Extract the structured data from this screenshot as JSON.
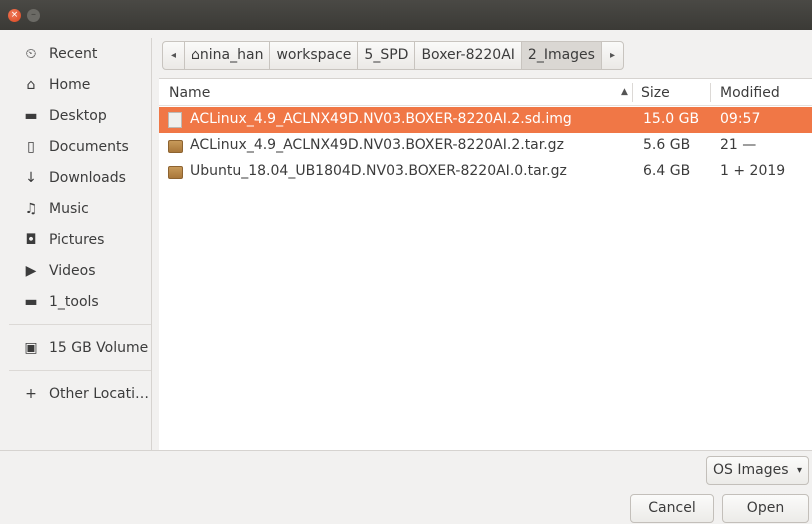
{
  "titlebar": {
    "close_glyph": "×",
    "minimize_glyph": "–"
  },
  "sidebar": {
    "items": [
      {
        "label": "Recent",
        "icon": "clock-icon"
      },
      {
        "label": "Home",
        "icon": "home-icon"
      },
      {
        "label": "Desktop",
        "icon": "folder-icon"
      },
      {
        "label": "Documents",
        "icon": "document-icon"
      },
      {
        "label": "Downloads",
        "icon": "download-icon"
      },
      {
        "label": "Music",
        "icon": "music-icon"
      },
      {
        "label": "Pictures",
        "icon": "camera-icon"
      },
      {
        "label": "Videos",
        "icon": "video-icon"
      },
      {
        "label": "1_tools",
        "icon": "folder-icon"
      },
      {
        "label": "15 GB Volume",
        "icon": "drive-icon"
      },
      {
        "label": "Other Locati…",
        "icon": "plus-icon"
      }
    ]
  },
  "pathbar": {
    "crumbs": [
      "nina_han",
      "workspace",
      "5_SPD",
      "Boxer-8220AI",
      "2_Images"
    ],
    "back_glyph": "◂",
    "forward_glyph": "▸",
    "home_glyph": "⌂"
  },
  "filelist": {
    "columns": {
      "name": "Name",
      "size": "Size",
      "modified": "Modified"
    },
    "sort_glyph": "▲",
    "rows": [
      {
        "name": "ACLinux_4.9_ACLNX49D.NV03.BOXER-8220AI.2.sd.img",
        "size": "15.0 GB",
        "modified": "09:57",
        "selected": true,
        "icon": "disk-image-icon"
      },
      {
        "name": "ACLinux_4.9_ACLNX49D.NV03.BOXER-8220AI.2.tar.gz",
        "size": "5.6 GB",
        "modified": "21 —",
        "selected": false,
        "icon": "archive-icon"
      },
      {
        "name": "Ubuntu_18.04_UB1804D.NV03.BOXER-8220AI.0.tar.gz",
        "size": "6.4 GB",
        "modified": "1 + 2019",
        "selected": false,
        "icon": "archive-icon"
      }
    ]
  },
  "bottombar": {
    "filter_label": "OS Images",
    "filter_caret": "▾",
    "cancel_label": "Cancel",
    "open_label": "Open"
  },
  "colors": {
    "accent": "#f07746",
    "titlebar": "#3f3e3a",
    "background": "#f2f1f0"
  }
}
